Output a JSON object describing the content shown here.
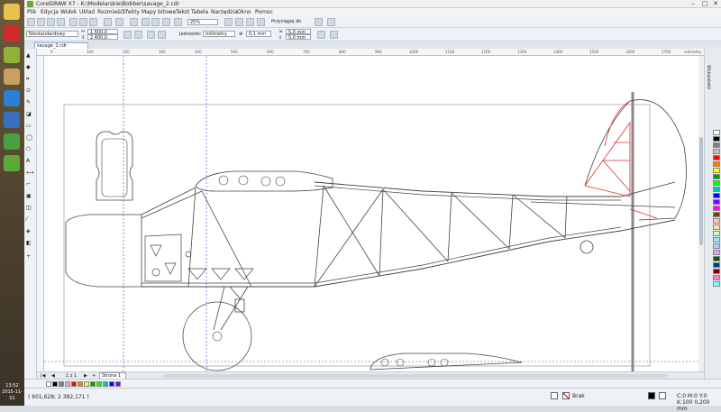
{
  "window": {
    "title": "CorelDRAW X7 - K:\\Modelarskie\\Bobber\\savage_2.cdr",
    "minimize": "–",
    "maximize": "□",
    "close": "✕"
  },
  "menu": [
    "Plik",
    "Edycja",
    "Widok",
    "Układ",
    "Rozmieść",
    "Efekty",
    "Mapy bitowe",
    "Tekst",
    "Tabela",
    "Narzędzia",
    "Okno",
    "Pomoc"
  ],
  "toolbar": {
    "zoom": "25%",
    "snap": "Przyciągaj do",
    "page_size": "Niestandardowy",
    "width": "1 600,0 mm",
    "height": "2 400,0 mm",
    "units_label": "Jednostki:",
    "units": "milimetry",
    "nudge": "0,1 mm",
    "dup_x": "5,0 mm",
    "dup_y": "5,0 mm"
  },
  "doc_tab": "savage_2.cdr",
  "ruler": {
    "h_ticks": [
      "0",
      "100",
      "200",
      "300",
      "400",
      "500",
      "600",
      "700",
      "800",
      "900",
      "1000",
      "1100",
      "1200",
      "1300",
      "1400",
      "1500",
      "1600",
      "1700"
    ],
    "unit": "milimetry"
  },
  "dock_label": "Wskazówki",
  "pages": {
    "count": "1 z 1",
    "current": "Strona 1"
  },
  "status": {
    "coords": "( 601,628; 2 382,171 )",
    "fill": "Brak",
    "outline": "C:0 M:0 Y:0 K:100  0,200 mm"
  },
  "clock": {
    "time": "13:52",
    "date": "2015-11-01"
  },
  "colors": {
    "palette": [
      "#ffffff",
      "#000000",
      "#808080",
      "#c0c0c0",
      "#ff0000",
      "#ff8000",
      "#ffff00",
      "#00a000",
      "#00ff00",
      "#00c0c0",
      "#0000ff",
      "#8000ff",
      "#ff00ff",
      "#804000",
      "#ffc0c0",
      "#ffe0a0",
      "#c0ffc0",
      "#a0e0ff",
      "#c0c0ff",
      "#e0a0ff",
      "#006000",
      "#004080",
      "#800000",
      "#ff80c0",
      "#80ffff"
    ],
    "accent": "#2b6cb8",
    "drawing": "#444444",
    "red_lines": "#e03030",
    "guides": "#3344cc"
  }
}
